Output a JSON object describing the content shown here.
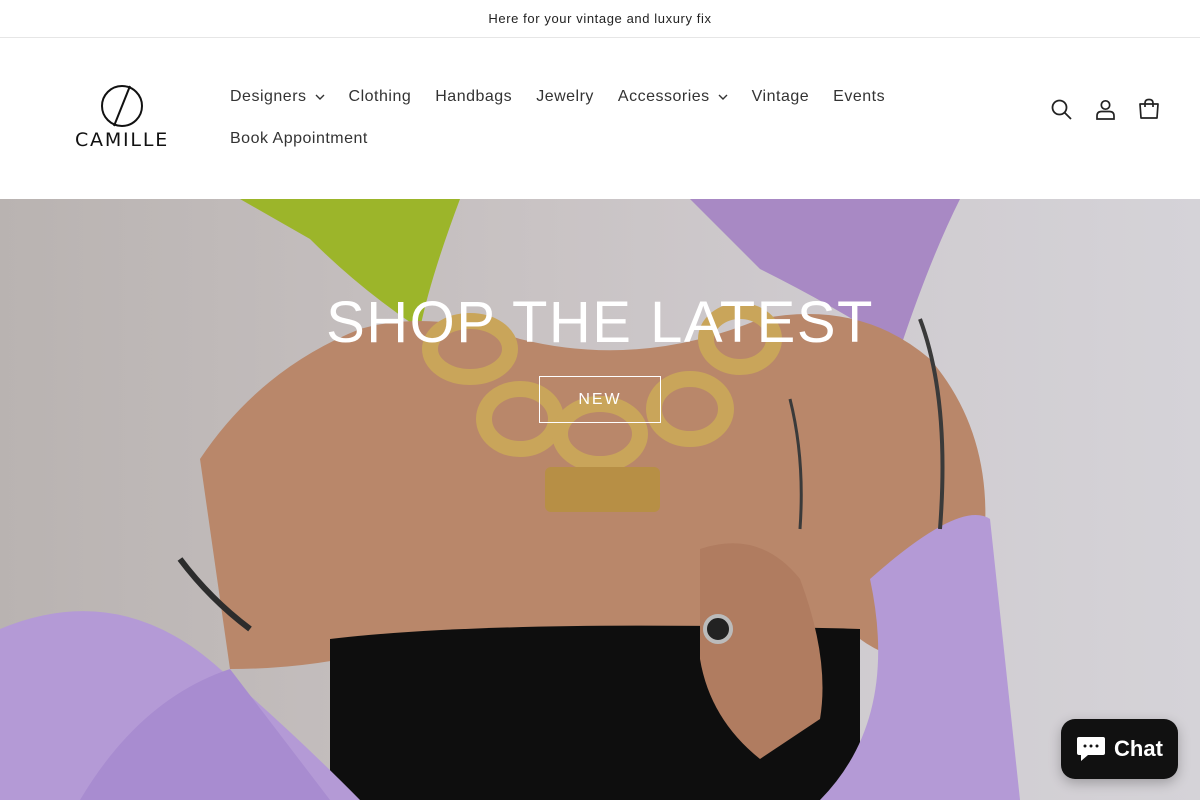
{
  "announcement": "Here for your vintage and luxury fix",
  "brand": {
    "name": "CAMILLE"
  },
  "nav": {
    "row1": [
      {
        "label": "Designers",
        "dropdown": true
      },
      {
        "label": "Clothing",
        "dropdown": false
      },
      {
        "label": "Handbags",
        "dropdown": false
      },
      {
        "label": "Jewelry",
        "dropdown": false
      },
      {
        "label": "Accessories",
        "dropdown": true
      },
      {
        "label": "Vintage",
        "dropdown": false
      },
      {
        "label": "Events",
        "dropdown": false
      }
    ],
    "row2": [
      {
        "label": "Book Appointment",
        "dropdown": false
      }
    ]
  },
  "header_icons": [
    "search-icon",
    "account-icon",
    "cart-icon"
  ],
  "hero": {
    "title": "SHOP THE LATEST",
    "button_label": "NEW"
  },
  "chat": {
    "label": "Chat",
    "icon": "chat-bubble-icon"
  },
  "colors": {
    "hair_green": "#9cb52a",
    "hair_purple": "#a889c4",
    "jacket_lilac": "#b49ad6",
    "gold": "#c9a55a",
    "chat_bg": "#111111"
  }
}
